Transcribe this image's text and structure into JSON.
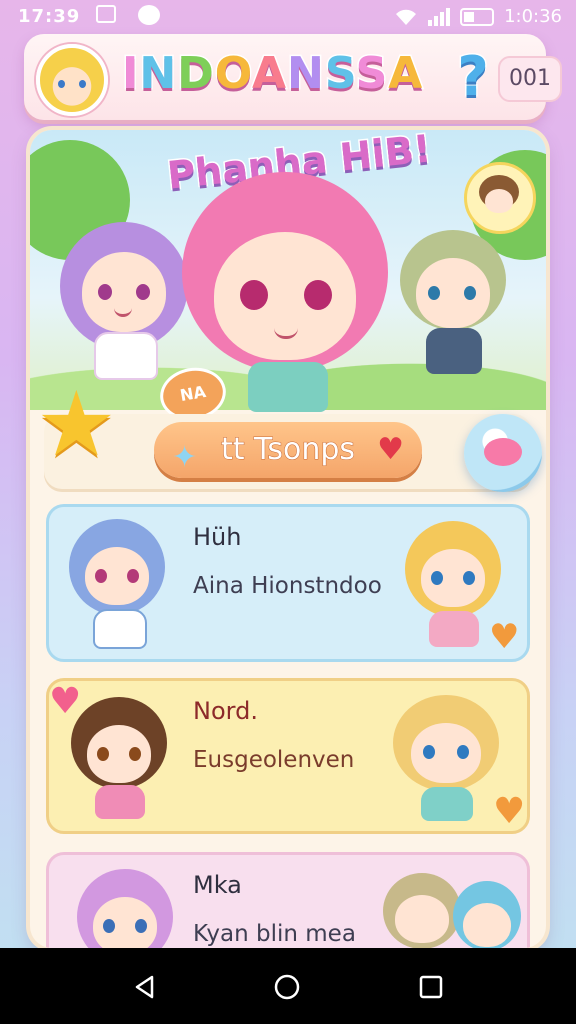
{
  "status_bar": {
    "time": "17:39",
    "clock": "1:0:36"
  },
  "header": {
    "app_title_letters": [
      "I",
      "N",
      "D",
      "O",
      "A",
      "N",
      "S",
      "S",
      "A",
      ""
    ],
    "app_title": "INDOANSSA",
    "level": "001",
    "help_icon": "question-mark-icon"
  },
  "hero": {
    "title": "Phanha HiB!",
    "badge": "NA"
  },
  "action": {
    "label": "tt Tsonps",
    "left_icon": "sparkle-icon",
    "right_icon": "heart-icon"
  },
  "cards": [
    {
      "title": "Hüh",
      "subtitle": "Aina Hionstndoo"
    },
    {
      "title": "Nord.",
      "subtitle": "Eusgeolenven"
    },
    {
      "title": "Mka",
      "subtitle": "Kyan blin mea"
    }
  ],
  "colors": {
    "accent_pink": "#f08bd7",
    "accent_orange": "#f4a56a",
    "card_blue": "#d6eef9",
    "card_yellow": "#fcefb2",
    "card_pink": "#f8dfee"
  }
}
